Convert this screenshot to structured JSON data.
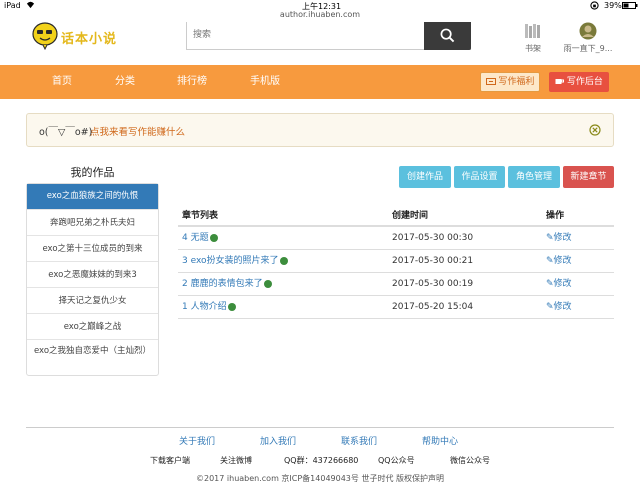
{
  "status_bar": {
    "device": "iPad",
    "time": "上午12:31",
    "battery": "39%"
  },
  "address_bar": {
    "url": "author.ihuaben.com"
  },
  "header": {
    "logo_text": "话本小说",
    "search": {
      "placeholder": "搜索",
      "value": ""
    },
    "shelf_label": "书架",
    "user_label": "雨一直下_9..."
  },
  "nav": {
    "items": [
      "首页",
      "分类",
      "排行榜",
      "手机版"
    ],
    "welfare_label": "写作福利",
    "backend_label": "写作后台"
  },
  "notice": {
    "emoticon": "o(￣▽￣o#)",
    "text": "点我来看写作能赚什么"
  },
  "sidebar": {
    "title": "我的作品",
    "items": [
      "exo之血狼族之间的仇恨",
      "奔跑吧兄弟之朴氏夫妇",
      "exo之第十三位成员的到来",
      "exo之恶魔妹妹的到来3",
      "择天记之复仇少女",
      "exo之巅峰之战",
      "exo之我独自恋爱中（主灿烈）"
    ]
  },
  "toolbar": {
    "create_work": "创建作品",
    "work_settings": "作品设置",
    "role_manage": "角色管理",
    "new_chapter": "新建章节"
  },
  "table": {
    "headers": [
      "章节列表",
      "创建时间",
      "操作"
    ],
    "rows": [
      {
        "title": "4 无题",
        "time": "2017-05-30 00:30",
        "action": "修改"
      },
      {
        "title": "3 exo扮女装的照片来了",
        "time": "2017-05-30 00:21",
        "action": "修改"
      },
      {
        "title": "2 鹿鹿的表情包来了",
        "time": "2017-05-30 00:19",
        "action": "修改"
      },
      {
        "title": "1 人物介绍",
        "time": "2017-05-20 15:04",
        "action": "修改"
      }
    ]
  },
  "footer": {
    "links": [
      "关于我们",
      "加入我们",
      "联系我们",
      "帮助中心"
    ],
    "info": [
      "下载客户端",
      "关注微博",
      "QQ群：437266680",
      "QQ公众号",
      "微信公众号"
    ],
    "copyright": "©2017 ihuaben.com 京ICP备14049043号  世子时代  版权保护声明"
  },
  "colors": {
    "nav_bg": "#f79a3e",
    "primary": "#337ab7",
    "info_button": "#5bc0de",
    "danger_button": "#d9534f",
    "backend_button": "#e8503f",
    "notice_text": "#d0681a"
  }
}
